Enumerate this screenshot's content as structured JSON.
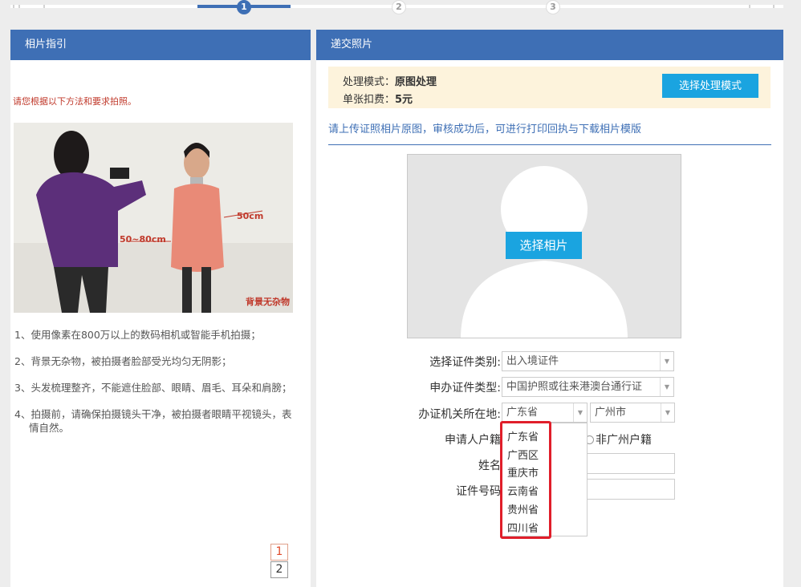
{
  "progress": {
    "steps": [
      "1",
      "2",
      "3"
    ],
    "active_step": 1
  },
  "left_panel": {
    "title": "相片指引",
    "intro": "请您根据以下方法和要求拍照。",
    "photo": {
      "distance_label": "50~80cm",
      "side_label": "50cm",
      "background_label": "背景无杂物"
    },
    "rules": [
      "1、使用像素在800万以上的数码相机或智能手机拍摄；",
      "2、背景无杂物，被拍摄者脸部受光均匀无阴影；",
      "3、头发梳理整齐，不能遮住脸部、眼睛、眉毛、耳朵和肩膀；",
      "4、拍摄前，请确保拍摄镜头干净，被拍摄者眼睛平视镜头，表情自然。"
    ],
    "pager": [
      "1",
      "2"
    ]
  },
  "right_panel": {
    "title": "递交照片",
    "mode": {
      "label1": "处理模式：",
      "value1": "原图处理",
      "label2": "单张扣费：",
      "value2": "5元",
      "button": "选择处理模式"
    },
    "upload_hint": "请上传证照相片原图，审核成功后，可进行打印回执与下载相片模版",
    "select_photo": "选择相片",
    "form": {
      "cert_category_label": "选择证件类别:",
      "cert_category_value": "出入境证件",
      "apply_type_label": "申办证件类型:",
      "apply_type_value": "中国护照或往来港澳台通行证",
      "office_location_label": "办证机关所在地:",
      "province_value": "广东省",
      "city_value": "广州市",
      "household_label": "申请人户籍",
      "household_option": "非广州户籍",
      "name_label": "姓名",
      "id_label": "证件号码"
    },
    "dropdown_options": [
      "广东省",
      "广西区",
      "重庆市",
      "云南省",
      "贵州省",
      "四川省"
    ]
  },
  "colors": {
    "primary": "#3e6fb5",
    "button": "#1aa4e0",
    "highlight": "#e01e2a",
    "mode_bg": "#fdf3dc"
  }
}
